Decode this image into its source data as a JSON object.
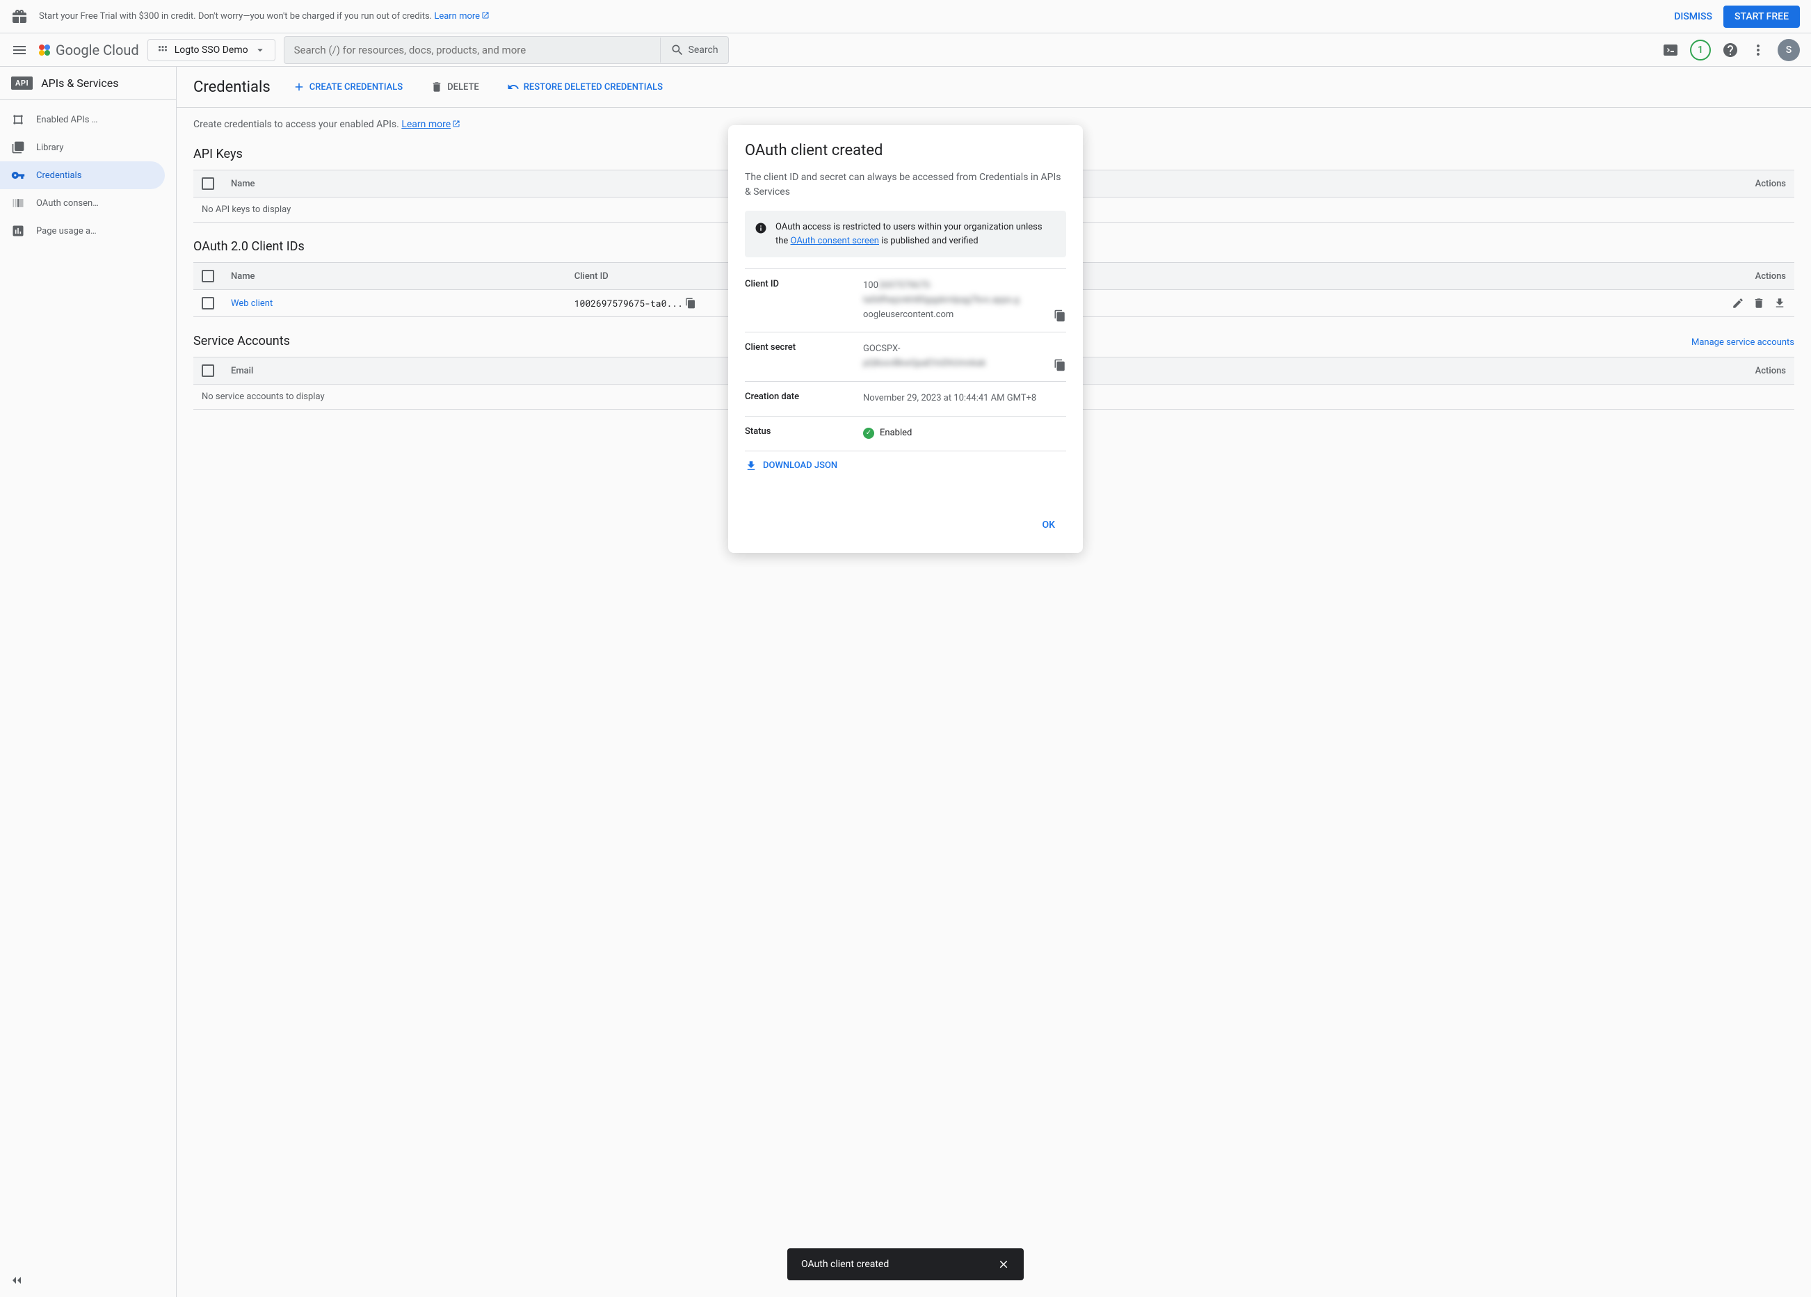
{
  "banner": {
    "text": "Start your Free Trial with $300 in credit. Don't worry—you won't be charged if you run out of credits. ",
    "learn_more": "Learn more",
    "dismiss": "DISMISS",
    "start_free": "START FREE"
  },
  "header": {
    "logo_text": "Google Cloud",
    "project": "Logto SSO Demo",
    "search_placeholder": "Search (/) for resources, docs, products, and more",
    "search_btn": "Search",
    "badge": "1",
    "avatar": "S"
  },
  "sidebar": {
    "badge": "API",
    "title": "APIs & Services",
    "items": [
      {
        "label": "Enabled APIs …"
      },
      {
        "label": "Library"
      },
      {
        "label": "Credentials"
      },
      {
        "label": "OAuth consen…"
      },
      {
        "label": "Page usage a…"
      }
    ]
  },
  "page": {
    "title": "Credentials",
    "create_btn": "CREATE CREDENTIALS",
    "delete_btn": "DELETE",
    "restore_btn": "RESTORE DELETED CREDENTIALS",
    "intro": "Create credentials to access your enabled APIs. ",
    "intro_link": "Learn more"
  },
  "api_keys": {
    "title": "API Keys",
    "columns": {
      "name": "Name",
      "actions": "Actions"
    },
    "empty": "No API keys to display"
  },
  "oauth_clients": {
    "title": "OAuth 2.0 Client IDs",
    "columns": {
      "name": "Name",
      "client_id": "Client ID",
      "actions": "Actions"
    },
    "rows": [
      {
        "name": "Web client",
        "client_id": "1002697579675-ta0..."
      }
    ]
  },
  "service_accounts": {
    "title": "Service Accounts",
    "manage_link": "Manage service accounts",
    "columns": {
      "email": "Email",
      "actions": "Actions"
    },
    "empty": "No service accounts to display"
  },
  "modal": {
    "title": "OAuth client created",
    "subtitle": "The client ID and secret can always be accessed from Credentials in APIs & Services",
    "info_pre": "OAuth access is restricted to users within your organization unless the ",
    "info_link": "OAuth consent screen",
    "info_post": " is published and verified",
    "client_id_label": "Client ID",
    "client_id_prefix": "100",
    "client_id_blur": "2697579675-",
    "client_id_blur2": "ta0dfhejznkh80gqpkmlpqg7bvx.apps.g",
    "client_id_suffix": "oogleusercontent.com",
    "client_secret_label": "Client secret",
    "client_secret_prefix": "GOCSPX-",
    "client_secret_blur": "pQ8oxvBkwQpaEVxDhUmnkak",
    "creation_label": "Creation date",
    "creation_value": "November 29, 2023 at 10:44:41 AM GMT+8",
    "status_label": "Status",
    "status_value": "Enabled",
    "download": "DOWNLOAD JSON",
    "ok": "OK"
  },
  "toast": {
    "text": "OAuth client created"
  }
}
